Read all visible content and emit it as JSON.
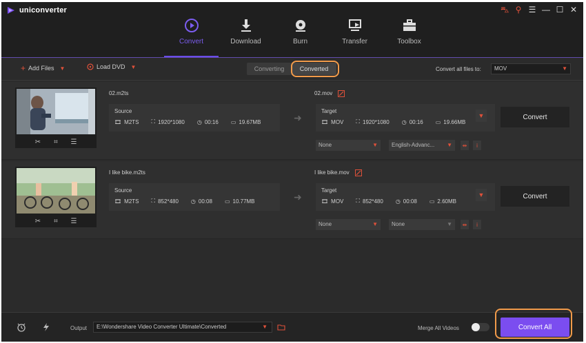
{
  "app": {
    "name": "uniconverter"
  },
  "window_controls": [
    "cart-icon",
    "key-icon",
    "menu-icon",
    "minimize-icon",
    "maximize-icon",
    "close-icon"
  ],
  "nav": [
    {
      "label": "Convert",
      "icon": "convert-icon",
      "active": true
    },
    {
      "label": "Download",
      "icon": "download-icon",
      "active": false
    },
    {
      "label": "Burn",
      "icon": "burn-icon",
      "active": false
    },
    {
      "label": "Transfer",
      "icon": "transfer-icon",
      "active": false
    },
    {
      "label": "Toolbox",
      "icon": "toolbox-icon",
      "active": false
    }
  ],
  "toolbar": {
    "add_files": "Add Files",
    "load_dvd": "Load DVD",
    "tabs": [
      "Converting",
      "Converted"
    ],
    "selected_tab": "Converted",
    "convert_all_label": "Convert all files to:",
    "convert_all_format": "MOV"
  },
  "files": [
    {
      "source_name": "02.m2ts",
      "source_label": "Source",
      "source": {
        "format": "M2TS",
        "resolution": "1920*1080",
        "duration": "00:16",
        "size": "19.67MB"
      },
      "target_name": "02.mov",
      "target_label": "Target",
      "target": {
        "format": "MOV",
        "resolution": "1920*1080",
        "duration": "00:16",
        "size": "19.66MB"
      },
      "subtitle": "None",
      "audio": "English-Advanc...",
      "convert_label": "Convert"
    },
    {
      "source_name": "I like bike.m2ts",
      "source_label": "Source",
      "source": {
        "format": "M2TS",
        "resolution": "852*480",
        "duration": "00:08",
        "size": "10.77MB"
      },
      "target_name": "I like bike.mov",
      "target_label": "Target",
      "target": {
        "format": "MOV",
        "resolution": "852*480",
        "duration": "00:08",
        "size": "2.60MB"
      },
      "subtitle": "None",
      "audio": "None",
      "convert_label": "Convert"
    }
  ],
  "bottom": {
    "output_label": "Output",
    "output_path": "E:\\Wondershare Video Converter Ultimate\\Converted",
    "merge_label": "Merge All Videos",
    "merge_enabled": false,
    "convert_all_button": "Convert All"
  },
  "colors": {
    "accent": "#7b4df0",
    "highlight": "#f29b4a",
    "caret": "#e0513a",
    "background": "#2b2b2b"
  }
}
